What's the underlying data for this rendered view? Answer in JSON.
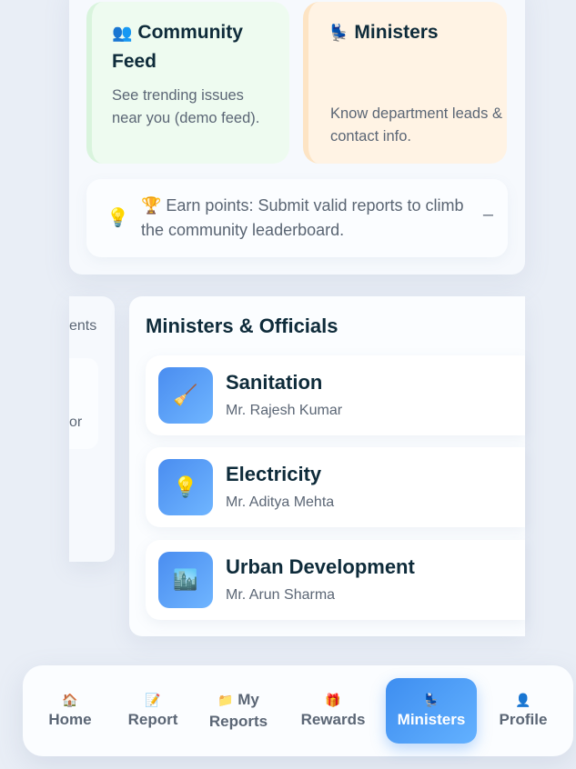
{
  "community_tile": {
    "icon": "people-icon",
    "icon_glyph": "👥",
    "title": "Community Feed",
    "description": "See trending issues near you (demo feed)."
  },
  "ministers_tile": {
    "icon": "seat-icon",
    "icon_glyph": "💺",
    "title": "Ministers",
    "description": "Know department leads & contact info."
  },
  "tip": {
    "bulb_glyph": "💡",
    "text": "🏆 Earn points: Submit valid reports to climb the community leaderboard.",
    "collapse_glyph": "–"
  },
  "left_panel": {
    "text_a": "ents",
    "text_b": "or"
  },
  "ministers_section": {
    "heading": "Ministers & Officials",
    "items": [
      {
        "icon": "broom-icon",
        "glyph": "🧹",
        "department": "Sanitation",
        "minister": "Mr. Rajesh Kumar"
      },
      {
        "icon": "bulb-icon",
        "glyph": "💡",
        "department": "Electricity",
        "minister": "Mr. Aditya Mehta"
      },
      {
        "icon": "city-icon",
        "glyph": "🏙️",
        "department": "Urban Development",
        "minister": "Mr. Arun Sharma"
      }
    ]
  },
  "nav": {
    "items": [
      {
        "icon": "home-icon",
        "glyph": "🏠",
        "label": "Home"
      },
      {
        "icon": "memo-icon",
        "glyph": "📝",
        "label": "Report"
      },
      {
        "icon": "folder-icon",
        "glyph": "📁",
        "label": "My Reports",
        "label_top": "My",
        "label_bottom": "Reports"
      },
      {
        "icon": "gift-icon",
        "glyph": "🎁",
        "label": "Rewards"
      },
      {
        "icon": "seat-icon",
        "glyph": "💺",
        "label": "Ministers",
        "active": true
      },
      {
        "icon": "user-icon",
        "glyph": "👤",
        "label": "Profile"
      }
    ]
  },
  "colors": {
    "accent": "#3e8ef0",
    "community_bg": "#eefbf0",
    "ministers_bg": "#fff3e4",
    "page_bg": "#e9eef6"
  }
}
